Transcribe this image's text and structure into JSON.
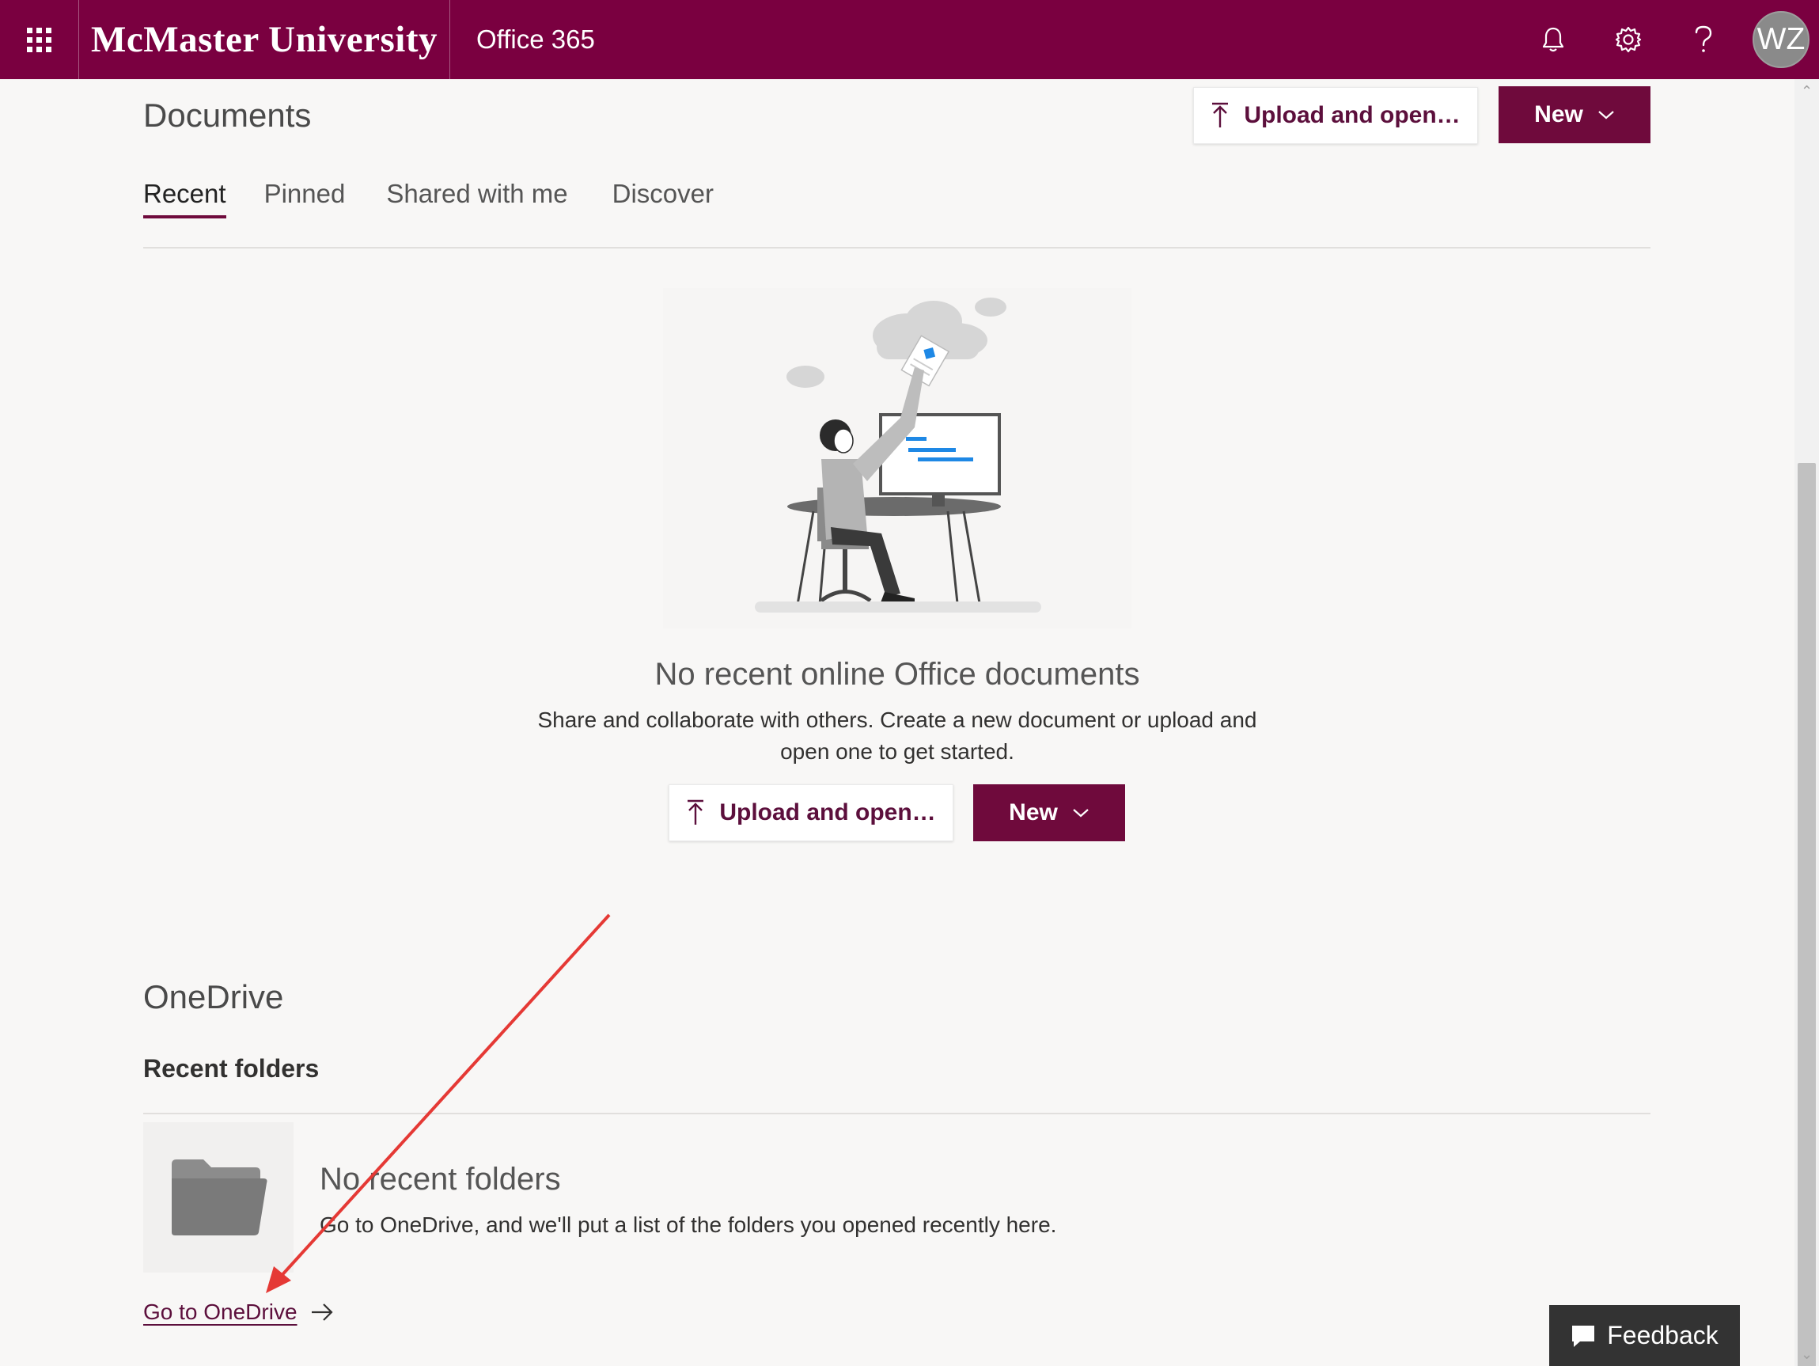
{
  "header": {
    "brand": "McMaster University",
    "app_name": "Office 365",
    "avatar_initials": "WZ",
    "theme_color": "#7a0040"
  },
  "documents": {
    "title": "Documents",
    "upload_label": "Upload and open…",
    "new_label": "New",
    "tabs": [
      {
        "label": "Recent",
        "active": true
      },
      {
        "label": "Pinned",
        "active": false
      },
      {
        "label": "Shared with me",
        "active": false
      },
      {
        "label": "Discover",
        "active": false
      }
    ],
    "empty_title": "No recent online Office documents",
    "empty_body": "Share and collaborate with others. Create a new document or upload and open one to get started.",
    "empty_upload_label": "Upload and open…",
    "empty_new_label": "New"
  },
  "onedrive": {
    "title": "OneDrive",
    "recent_folders_heading": "Recent folders",
    "no_folders_title": "No recent folders",
    "no_folders_body": "Go to OneDrive, and we'll put a list of the folders you opened recently here.",
    "go_link": "Go to OneDrive"
  },
  "feedback": {
    "label": "Feedback"
  },
  "annotation": {
    "color": "#e53935"
  }
}
